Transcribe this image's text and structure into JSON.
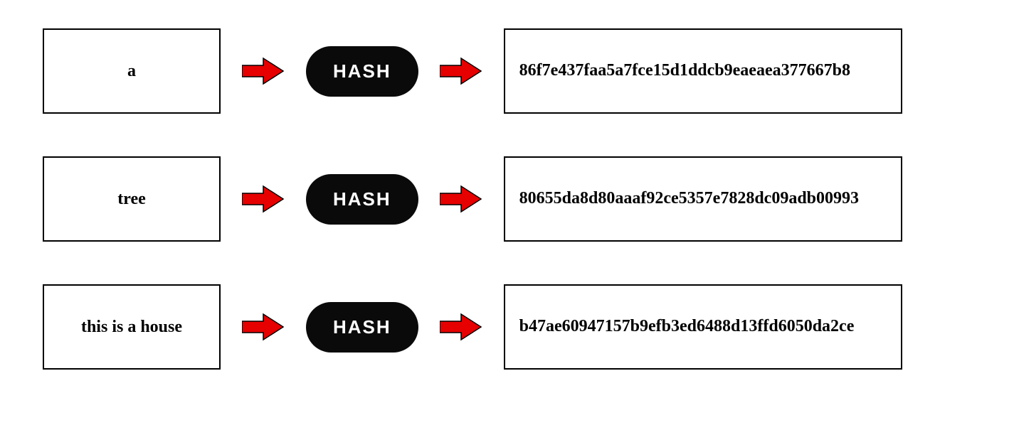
{
  "hash_label": "HASH",
  "rows": [
    {
      "input": "a",
      "output": "86f7e437faa5a7fce15d1ddcb9eaeaea377667b8"
    },
    {
      "input": "tree",
      "output": "80655da8d80aaaf92ce5357e7828dc09adb00993"
    },
    {
      "input": "this is a house",
      "output": "b47ae60947157b9efb3ed6488d13ffd6050da2ce"
    }
  ]
}
